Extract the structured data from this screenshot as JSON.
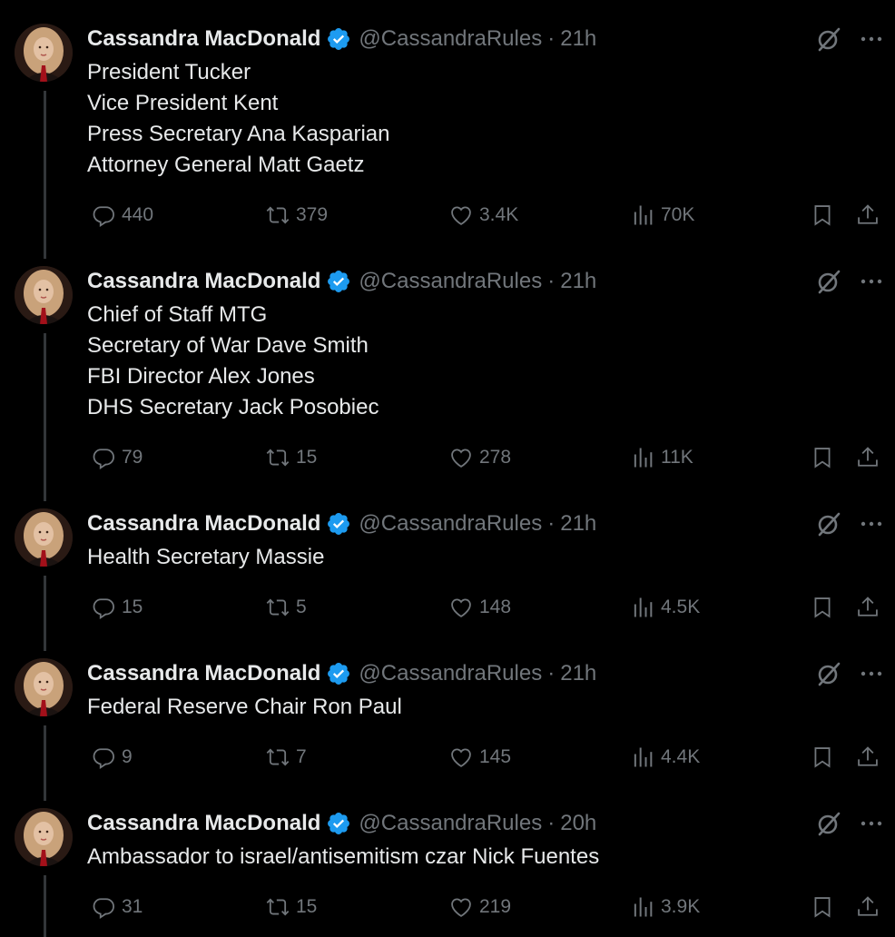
{
  "colors": {
    "background": "#000000",
    "text": "#e7e9ea",
    "secondary": "#71767b",
    "verified": "#1d9bf0",
    "thread_line": "#333639"
  },
  "tweets": [
    {
      "name": "Cassandra MacDonald",
      "handle": "@CassandraRules",
      "sep": "·",
      "time": "21h",
      "lines": [
        "President Tucker",
        "Vice President Kent",
        "Press Secretary Ana Kasparian",
        "Attorney General Matt Gaetz"
      ],
      "replies": "440",
      "retweets": "379",
      "likes": "3.4K",
      "views": "70K"
    },
    {
      "name": "Cassandra MacDonald",
      "handle": "@CassandraRules",
      "sep": "·",
      "time": "21h",
      "lines": [
        "Chief of Staff MTG",
        "Secretary of War Dave Smith",
        "FBI Director Alex Jones",
        "DHS Secretary Jack Posobiec"
      ],
      "replies": "79",
      "retweets": "15",
      "likes": "278",
      "views": "11K"
    },
    {
      "name": "Cassandra MacDonald",
      "handle": "@CassandraRules",
      "sep": "·",
      "time": "21h",
      "lines": [
        "Health Secretary Massie"
      ],
      "replies": "15",
      "retweets": "5",
      "likes": "148",
      "views": "4.5K"
    },
    {
      "name": "Cassandra MacDonald",
      "handle": "@CassandraRules",
      "sep": "·",
      "time": "21h",
      "lines": [
        "Federal Reserve Chair Ron Paul"
      ],
      "replies": "9",
      "retweets": "7",
      "likes": "145",
      "views": "4.4K"
    },
    {
      "name": "Cassandra MacDonald",
      "handle": "@CassandraRules",
      "sep": "·",
      "time": "20h",
      "lines": [
        "Ambassador to israel/antisemitism czar Nick Fuentes"
      ],
      "replies": "31",
      "retweets": "15",
      "likes": "219",
      "views": "3.9K"
    }
  ]
}
